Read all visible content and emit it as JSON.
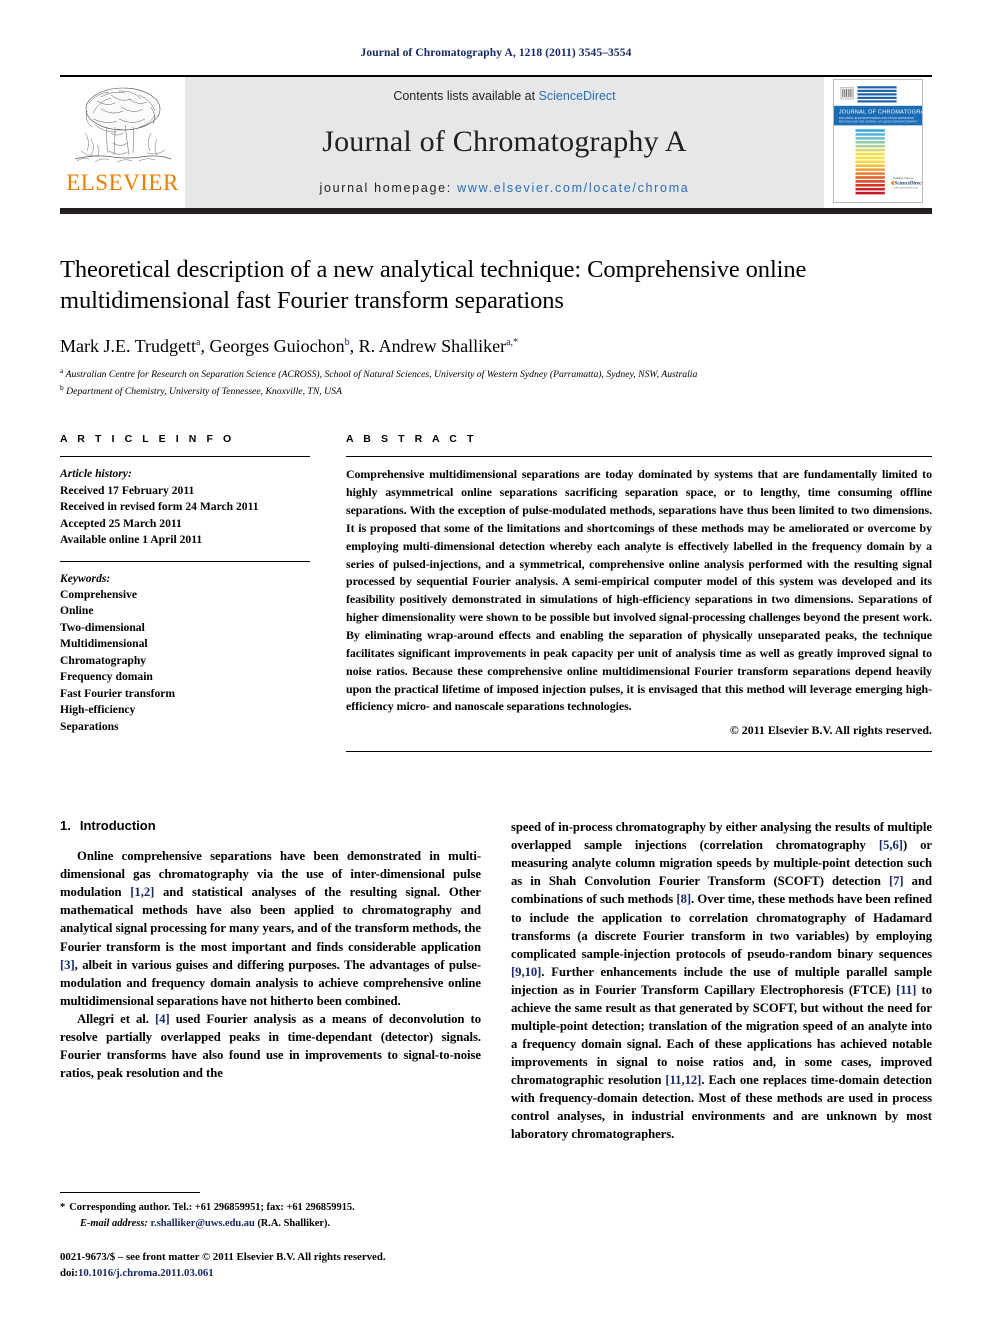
{
  "running_head": "Journal of Chromatography A, 1218 (2011) 3545–3554",
  "masthead": {
    "publisher_name": "ELSEVIER",
    "contents_prefix": "Contents lists available at ",
    "contents_link": "ScienceDirect",
    "journal_name": "Journal of Chromatography A",
    "homepage_prefix": "journal homepage: ",
    "homepage_url": "www.elsevier.com/locate/chroma",
    "cover": {
      "title": "JOURNAL OF CHROMATOGRAPHY A",
      "subtitle": "INCLUDING: ELECTROPHORESIS AND OTHER SEPARATION METHODS AND THE JOURNAL OF LIQUID CHROMATOGRAPHY",
      "badge_available": "Available online at",
      "badge_brand": "ScienceDirect",
      "badge_sub": "www.sciencedirect.com"
    }
  },
  "article": {
    "title": "Theoretical description of a new analytical technique: Comprehensive online multidimensional fast Fourier transform separations",
    "authors_html": "Mark J.E. Trudgett",
    "authors_plain": "Mark J.E. Trudgett a, Georges Guiochon b, R. Andrew Shalliker a,*",
    "affiliation_a": "Australian Centre for Research on Separation Science (ACROSS), School of Natural Sciences, University of Western Sydney (Parramatta), Sydney, NSW, Australia",
    "affiliation_b": "Department of Chemistry, University of Tennessee, Knoxville, TN, USA"
  },
  "article_info": {
    "heading": "A R T I C L E  I N F O",
    "history_label": "Article history:",
    "history_items": [
      "Received 17 February 2011",
      "Received in revised form 24 March 2011",
      "Accepted 25 March 2011",
      "Available online 1 April 2011"
    ],
    "keywords_label": "Keywords:",
    "keywords": [
      "Comprehensive",
      "Online",
      "Two-dimensional",
      "Multidimensional",
      "Chromatography",
      "Frequency domain",
      "Fast Fourier transform",
      "High-efficiency",
      "Separations"
    ]
  },
  "abstract": {
    "heading": "A B S T R A C T",
    "text": "Comprehensive multidimensional separations are today dominated by systems that are fundamentally limited to highly asymmetrical online separations sacrificing separation space, or to lengthy, time consuming offline separations. With the exception of pulse-modulated methods, separations have thus been limited to two dimensions. It is proposed that some of the limitations and shortcomings of these methods may be ameliorated or overcome by employing multi-dimensional detection whereby each analyte is effectively labelled in the frequency domain by a series of pulsed-injections, and a symmetrical, comprehensive online analysis performed with the resulting signal processed by sequential Fourier analysis. A semi-empirical computer model of this system was developed and its feasibility positively demonstrated in simulations of high-efficiency separations in two dimensions. Separations of higher dimensionality were shown to be possible but involved signal-processing challenges beyond the present work. By eliminating wrap-around effects and enabling the separation of physically unseparated peaks, the technique facilitates significant improvements in peak capacity per unit of analysis time as well as greatly improved signal to noise ratios. Because these comprehensive online multidimensional Fourier transform separations depend heavily upon the practical lifetime of imposed injection pulses, it is envisaged that this method will leverage emerging high-efficiency micro- and nanoscale separations technologies.",
    "copyright": "© 2011 Elsevier B.V. All rights reserved."
  },
  "introduction": {
    "number": "1.",
    "heading": "Introduction",
    "para1_a": "Online comprehensive separations have been demonstrated in multi-dimensional gas chromatography via the use of inter-dimensional pulse modulation ",
    "ref_12": "[1,2]",
    "para1_b": " and statistical analyses of the resulting signal. Other mathematical methods have also been applied to chromatography and analytical signal processing for many years, and of the transform methods, the Fourier transform is the most important and finds considerable application ",
    "ref_3": "[3]",
    "para1_c": ", albeit in various guises and differing purposes. The advantages of pulse-modulation and frequency domain analysis to achieve comprehensive online multidimensional separations have not hitherto been combined.",
    "para2_a": "Allegri et al. ",
    "ref_4": "[4]",
    "para2_b": " used Fourier analysis as a means of deconvolution to resolve partially overlapped peaks in time-dependant (detector) signals. Fourier transforms have also found use in improvements to signal-to-noise ratios, peak resolution and the",
    "para3_a": "speed of in-process chromatography by either analysing the results of multiple overlapped sample injections (correlation chromatography ",
    "ref_56": "[5,6]",
    "para3_b": ") or measuring analyte column migration speeds by multiple-point detection such as in Shah Convolution Fourier Transform (SCOFT) detection ",
    "ref_7": "[7]",
    "para3_c": " and combinations of such methods ",
    "ref_8": "[8]",
    "para3_d": ". Over time, these methods have been refined to include the application to correlation chromatography of Hadamard transforms (a discrete Fourier transform in two variables) by employing complicated sample-injection protocols of pseudo-random binary sequences ",
    "ref_910": "[9,10]",
    "para3_e": ". Further enhancements include the use of multiple parallel sample injection as in Fourier Transform Capillary Electrophoresis (FTCE) ",
    "ref_11": "[11]",
    "para3_f": " to achieve the same result as that generated by SCOFT, but without the need for multiple-point detection; translation of the migration speed of an analyte into a frequency domain signal. Each of these applications has achieved notable improvements in signal to noise ratios and, in some cases, improved chromatographic resolution ",
    "ref_1112": "[11,12]",
    "para3_g": ". Each one replaces time-domain detection with frequency-domain detection. Most of these methods are used in process control analyses, in industrial environments and are unknown by most laboratory chromatographers."
  },
  "footnote": {
    "star": "*",
    "corresponding": "Corresponding author. Tel.: +61 296859951; fax: +61 296859915.",
    "email_label": "E-mail address:",
    "email": "r.shalliker@uws.edu.au",
    "email_owner": "(R.A. Shalliker).",
    "issn_line": "0021-9673/$ – see front matter © 2011 Elsevier B.V. All rights reserved.",
    "doi_prefix": "doi:",
    "doi": "10.1016/j.chroma.2011.03.061"
  },
  "colors": {
    "link": "#17286b",
    "sciencedirect": "#2a6ebb",
    "elsevier_orange": "#f07d00",
    "masthead_grey": "#e6e7e8"
  }
}
